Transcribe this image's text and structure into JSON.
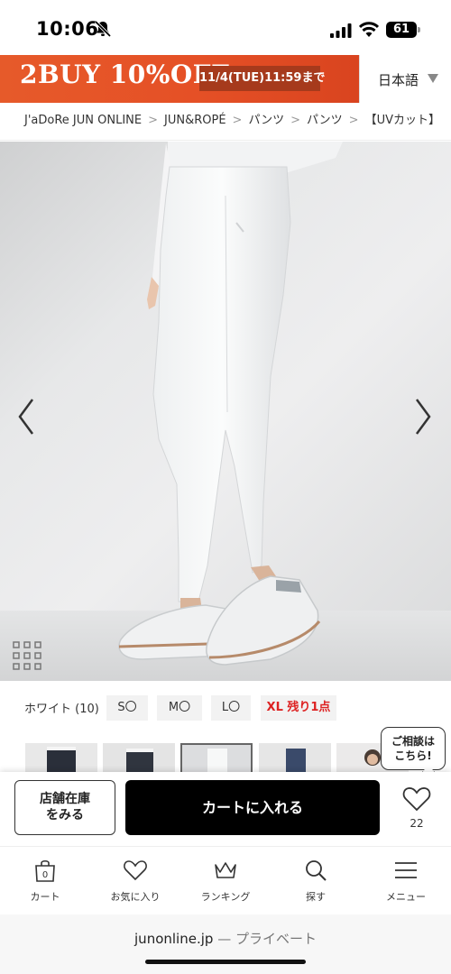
{
  "status_bar": {
    "time": "10:06",
    "battery": "61"
  },
  "banner": {
    "main_text": "2BUY 10%OFF",
    "date_text": "11/4(TUE)11:59まで"
  },
  "language_select": {
    "selected": "日本語"
  },
  "breadcrumb": {
    "items": [
      "J'aDoRe JUN ONLINE",
      "JUN&ROPÉ",
      "パンツ",
      "パンツ",
      "【UVカット】"
    ],
    "separator": ">"
  },
  "variants": {
    "color_label": "ホワイト (10)",
    "sizes": [
      {
        "label": "S〇",
        "low_stock": false
      },
      {
        "label": "M〇",
        "low_stock": false
      },
      {
        "label": "L〇",
        "low_stock": false
      },
      {
        "label": "XL 残り1点",
        "low_stock": true
      }
    ]
  },
  "chat": {
    "line1": "ご相談は",
    "line2": "こちら!"
  },
  "cart_bar": {
    "store_stock_line1": "店舗在庫",
    "store_stock_line2": "をみる",
    "add_to_cart": "カートに入れる",
    "favorite_count": "22"
  },
  "tab_bar": {
    "cart_badge": "0",
    "tabs": [
      "カート",
      "お気に入り",
      "ランキング",
      "探す",
      "メニュー"
    ]
  },
  "url_bar": {
    "domain": "junonline.jp",
    "suffix": "— プライベート"
  },
  "colors": {
    "accent_orange": "#e55026",
    "low_stock_red": "#dd2222",
    "primary_button": "#000000"
  }
}
